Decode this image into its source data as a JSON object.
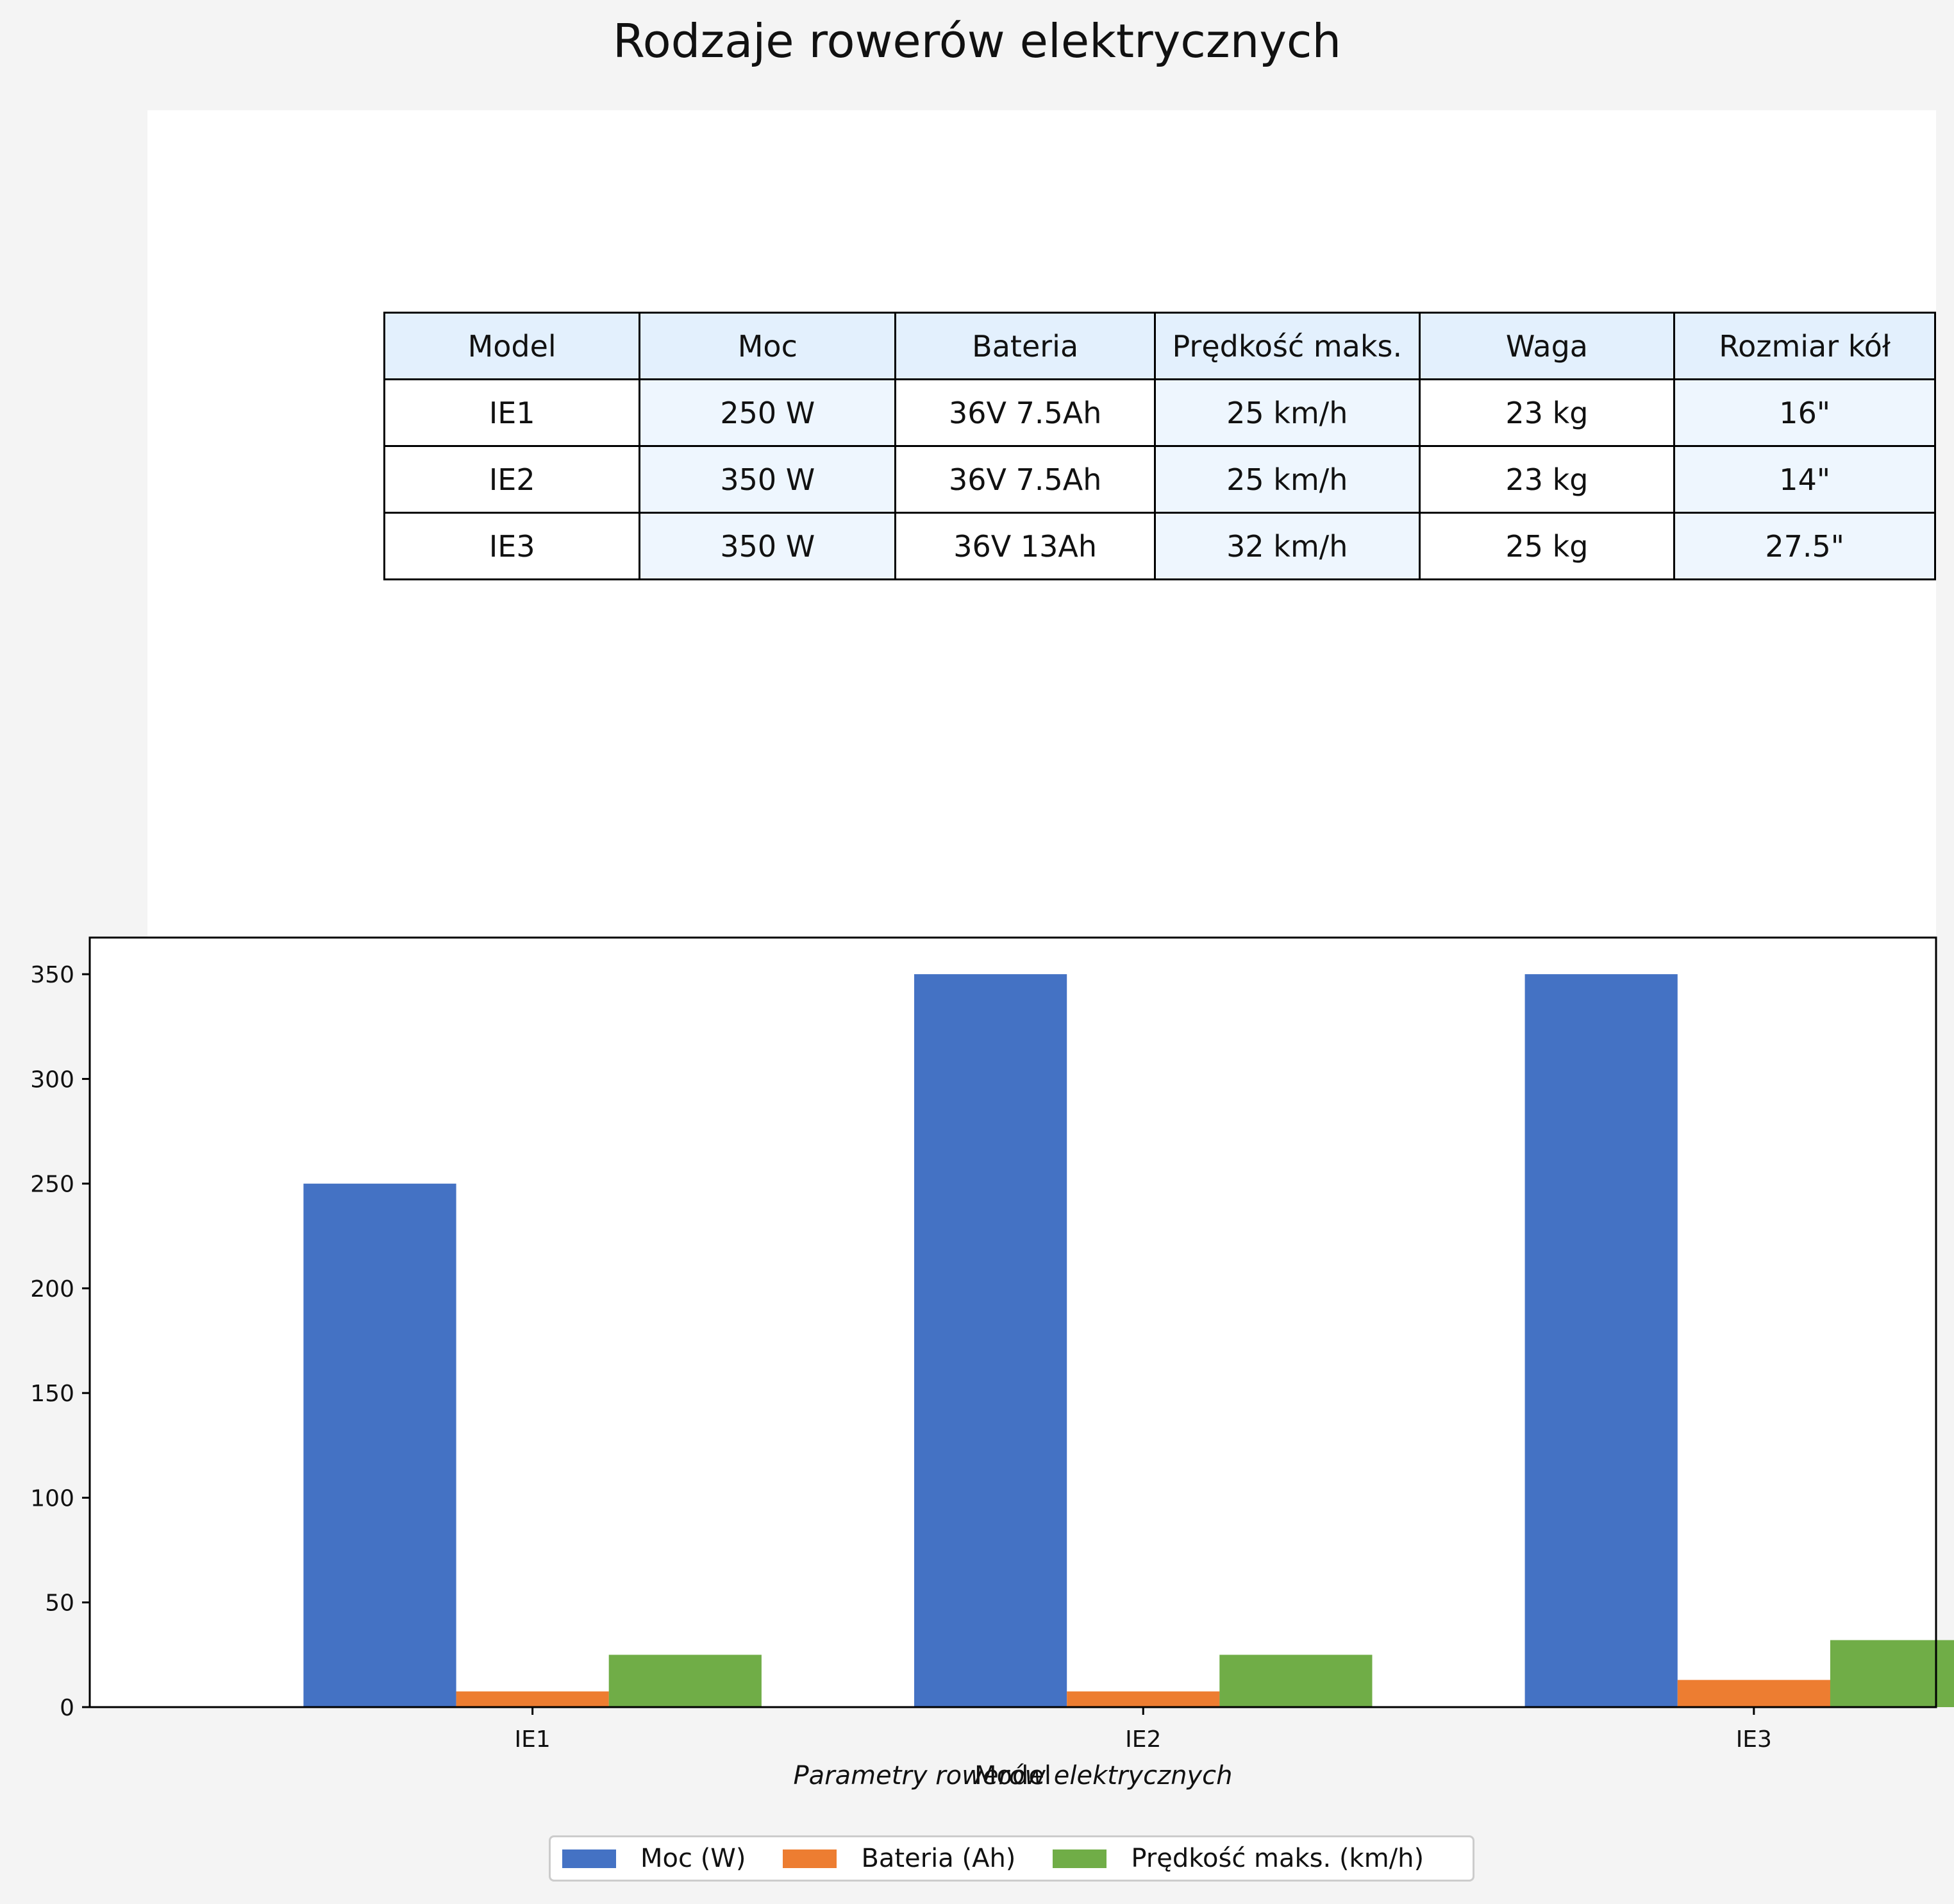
{
  "title": "Rodzaje rowerów elektrycznych",
  "table": {
    "headers": [
      "Model",
      "Moc",
      "Bateria",
      "Prędkość maks.",
      "Waga",
      "Rozmiar kół"
    ],
    "rows": [
      [
        "IE1",
        "250 W",
        "36V 7.5Ah",
        "25 km/h",
        "23 kg",
        "16\""
      ],
      [
        "IE2",
        "350 W",
        "36V 7.5Ah",
        "25 km/h",
        "23 kg",
        "14\""
      ],
      [
        "IE3",
        "350 W",
        "36V 13Ah",
        "32 km/h",
        "25 kg",
        "27.5\""
      ]
    ]
  },
  "chart_data": {
    "type": "bar",
    "categories": [
      "IE1",
      "IE2",
      "IE3"
    ],
    "series": [
      {
        "name": "Moc (W)",
        "values": [
          250,
          350,
          350
        ],
        "color": "#4472c4"
      },
      {
        "name": "Bateria (Ah)",
        "values": [
          7.5,
          7.5,
          13
        ],
        "color": "#ed7d31"
      },
      {
        "name": "Prędkość maks. (km/h)",
        "values": [
          25,
          25,
          32
        ],
        "color": "#70ad47"
      }
    ],
    "xlabel": "Model",
    "ylabel": "",
    "caption": "Parametry rowerów elektrycznych",
    "ylim": [
      0,
      367.5
    ],
    "yticks": [
      0,
      50,
      100,
      150,
      200,
      250,
      300,
      350
    ],
    "grid": false,
    "legend_position": "bottom-center"
  }
}
